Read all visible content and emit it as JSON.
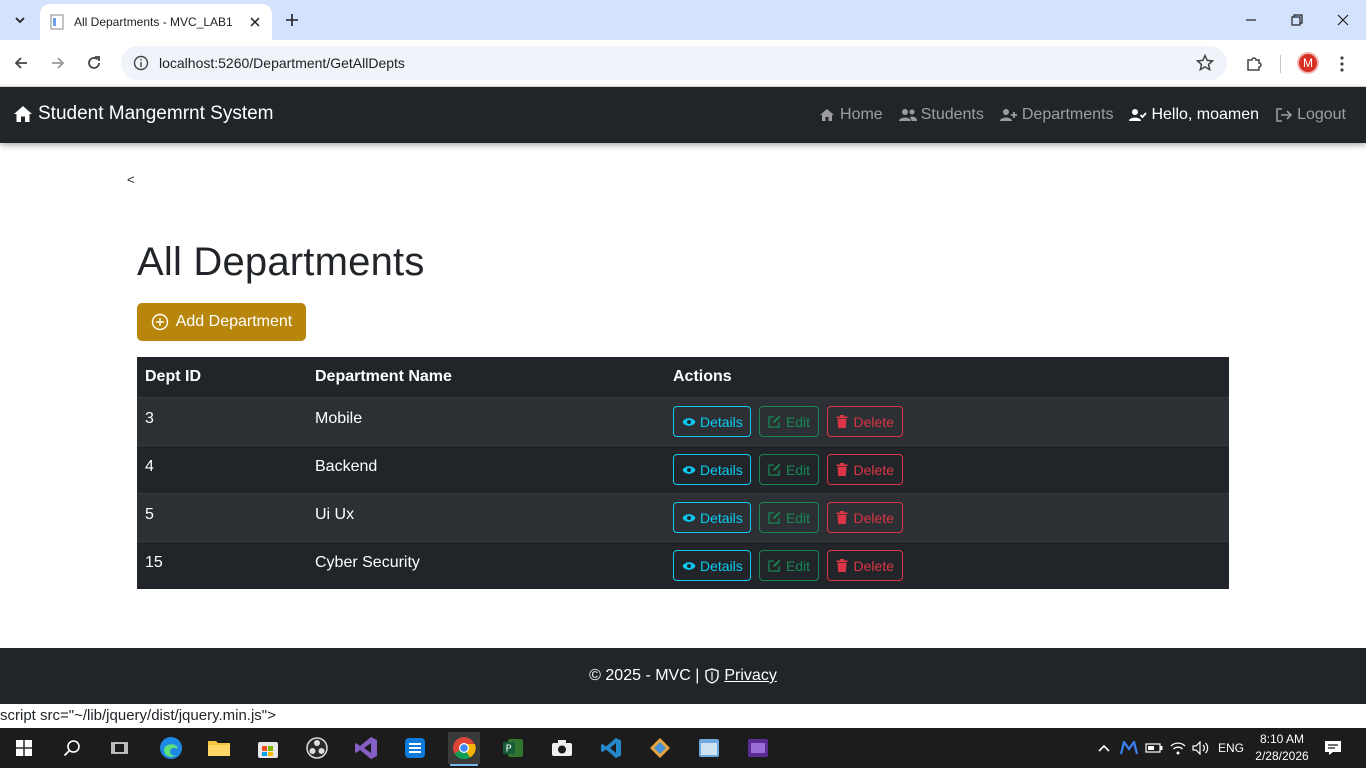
{
  "browser": {
    "tab_title": "All Departments - MVC_LAB1",
    "url": "localhost:5260/Department/GetAllDepts",
    "profile_initial": "M"
  },
  "navbar": {
    "brand": "Student Mangemrnt System",
    "links": [
      {
        "label": "Home",
        "icon": "home-icon"
      },
      {
        "label": "Students",
        "icon": "users-icon"
      },
      {
        "label": "Departments",
        "icon": "user-plus-icon"
      }
    ],
    "user_greeting": "Hello, moamen",
    "logout_label": "Logout"
  },
  "page": {
    "stray_text": "<",
    "title": "All Departments",
    "add_button_label": "Add Department"
  },
  "table": {
    "headers": [
      "Dept ID",
      "Department Name",
      "Actions"
    ],
    "rows": [
      {
        "id": "3",
        "name": "Mobile"
      },
      {
        "id": "4",
        "name": "Backend"
      },
      {
        "id": "5",
        "name": "Ui Ux"
      },
      {
        "id": "15",
        "name": "Cyber Security"
      }
    ],
    "actions": {
      "details": "Details",
      "edit": "Edit",
      "delete": "Delete"
    }
  },
  "footer": {
    "copyright": "© 2025 - MVC |",
    "privacy_label": "Privacy"
  },
  "leaked_text": "script src=\"~/lib/jquery/dist/jquery.min.js\">",
  "taskbar": {
    "language": "ENG",
    "time": "8:10 AM",
    "date": "2/28/2026"
  },
  "colors": {
    "navbar_bg": "#212529",
    "add_button": "#b8860b",
    "details": "#0dcaf0",
    "edit": "#198754",
    "delete": "#dc3545"
  }
}
